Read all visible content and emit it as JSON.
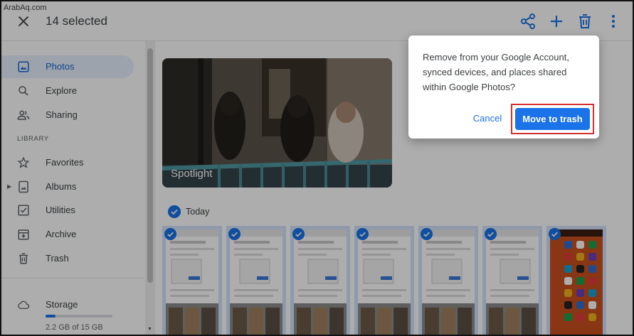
{
  "watermark": "ArabAq.com",
  "header": {
    "selected_count": "14 selected"
  },
  "icons": {
    "close": "close-icon",
    "share": "share-icon",
    "add": "plus-icon",
    "delete": "trash-icon",
    "more": "more-vert-icon"
  },
  "sidebar": {
    "items": [
      {
        "label": "Photos",
        "icon": "photo-icon",
        "active": true
      },
      {
        "label": "Explore",
        "icon": "search-icon"
      },
      {
        "label": "Sharing",
        "icon": "people-icon"
      }
    ],
    "library_heading": "LIBRARY",
    "library_items": [
      {
        "label": "Favorites",
        "icon": "star-icon"
      },
      {
        "label": "Albums",
        "icon": "album-icon"
      },
      {
        "label": "Utilities",
        "icon": "checkbox-icon"
      },
      {
        "label": "Archive",
        "icon": "archive-icon"
      },
      {
        "label": "Trash",
        "icon": "trash-icon"
      }
    ],
    "storage": {
      "label": "Storage",
      "usage_text": "2.2 GB of 15 GB",
      "used_fraction": 0.15
    }
  },
  "main": {
    "spotlight_label": "Spotlight",
    "date_group": "Today",
    "thumbnail_count": 7
  },
  "dialog": {
    "message": "Remove from your Google Account, synced devices, and places shared within Google Photos?",
    "cancel_label": "Cancel",
    "confirm_label": "Move to trash"
  },
  "colors": {
    "accent": "#1a73e8",
    "highlight_outline": "#d32f2f",
    "selected_tile": "#d2e3fc"
  }
}
